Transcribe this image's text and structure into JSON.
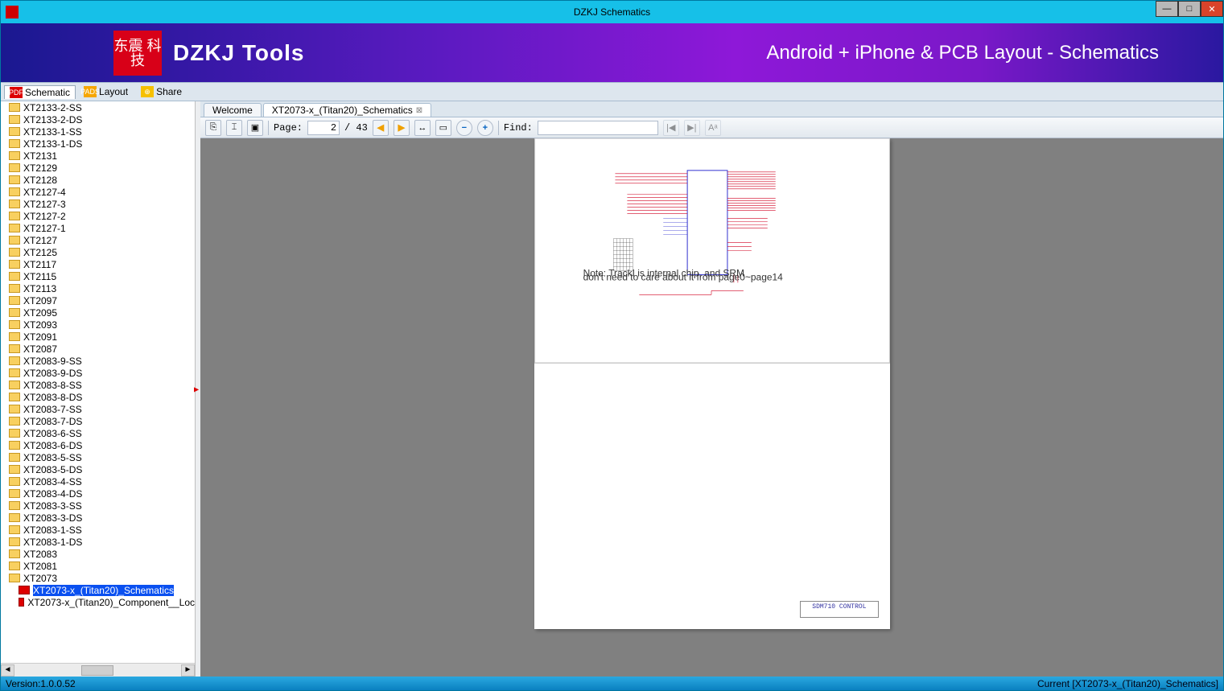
{
  "window": {
    "title": "DZKJ Schematics"
  },
  "banner": {
    "logo_text": "东震\n科技",
    "left": "DZKJ Tools",
    "right": "Android + iPhone & PCB Layout - Schematics"
  },
  "sidetabs": [
    {
      "icon": "pdf",
      "label": "Schematic",
      "active": true
    },
    {
      "icon": "pads",
      "label": "Layout"
    },
    {
      "icon": "share",
      "label": "Share"
    }
  ],
  "tree": {
    "items": [
      {
        "t": "folder",
        "label": "XT2133-2-SS"
      },
      {
        "t": "folder",
        "label": "XT2133-2-DS"
      },
      {
        "t": "folder",
        "label": "XT2133-1-SS"
      },
      {
        "t": "folder",
        "label": "XT2133-1-DS"
      },
      {
        "t": "folder",
        "label": "XT2131"
      },
      {
        "t": "folder",
        "label": "XT2129"
      },
      {
        "t": "folder",
        "label": "XT2128"
      },
      {
        "t": "folder",
        "label": "XT2127-4"
      },
      {
        "t": "folder",
        "label": "XT2127-3"
      },
      {
        "t": "folder",
        "label": "XT2127-2"
      },
      {
        "t": "folder",
        "label": "XT2127-1"
      },
      {
        "t": "folder",
        "label": "XT2127"
      },
      {
        "t": "folder",
        "label": "XT2125"
      },
      {
        "t": "folder",
        "label": "XT2117"
      },
      {
        "t": "folder",
        "label": "XT2115"
      },
      {
        "t": "folder",
        "label": "XT2113"
      },
      {
        "t": "folder",
        "label": "XT2097"
      },
      {
        "t": "folder",
        "label": "XT2095"
      },
      {
        "t": "folder",
        "label": "XT2093"
      },
      {
        "t": "folder",
        "label": "XT2091"
      },
      {
        "t": "folder",
        "label": "XT2087"
      },
      {
        "t": "folder",
        "label": "XT2083-9-SS"
      },
      {
        "t": "folder",
        "label": "XT2083-9-DS"
      },
      {
        "t": "folder",
        "label": "XT2083-8-SS"
      },
      {
        "t": "folder",
        "label": "XT2083-8-DS"
      },
      {
        "t": "folder",
        "label": "XT2083-7-SS"
      },
      {
        "t": "folder",
        "label": "XT2083-7-DS"
      },
      {
        "t": "folder",
        "label": "XT2083-6-SS"
      },
      {
        "t": "folder",
        "label": "XT2083-6-DS"
      },
      {
        "t": "folder",
        "label": "XT2083-5-SS"
      },
      {
        "t": "folder",
        "label": "XT2083-5-DS"
      },
      {
        "t": "folder",
        "label": "XT2083-4-SS"
      },
      {
        "t": "folder",
        "label": "XT2083-4-DS"
      },
      {
        "t": "folder",
        "label": "XT2083-3-SS"
      },
      {
        "t": "folder",
        "label": "XT2083-3-DS"
      },
      {
        "t": "folder",
        "label": "XT2083-1-SS"
      },
      {
        "t": "folder",
        "label": "XT2083-1-DS"
      },
      {
        "t": "folder",
        "label": "XT2083"
      },
      {
        "t": "folder",
        "label": "XT2081"
      },
      {
        "t": "folder",
        "label": "XT2073"
      },
      {
        "t": "pdf",
        "label": "XT2073-x_(Titan20)_Schematics",
        "selected": true
      },
      {
        "t": "pdf",
        "label": "XT2073-x_(Titan20)_Component__Loc"
      }
    ]
  },
  "doc_tabs": [
    {
      "label": "Welcome",
      "active": false,
      "closable": false
    },
    {
      "label": "XT2073-x_(Titan20)_Schematics",
      "active": true,
      "closable": true
    }
  ],
  "toolbar": {
    "page_label": "Page:",
    "page_current": "2",
    "page_total": "/ 43",
    "find_label": "Find:"
  },
  "page": {
    "title_block": "SDM710 CONTROL",
    "note": "Note: TrackI is internal chip, and SRM\ndon't need to care about it from page0~page14"
  },
  "status": {
    "left": "Version:1.0.0.52",
    "right": "Current [XT2073-x_(Titan20)_Schematics]"
  }
}
